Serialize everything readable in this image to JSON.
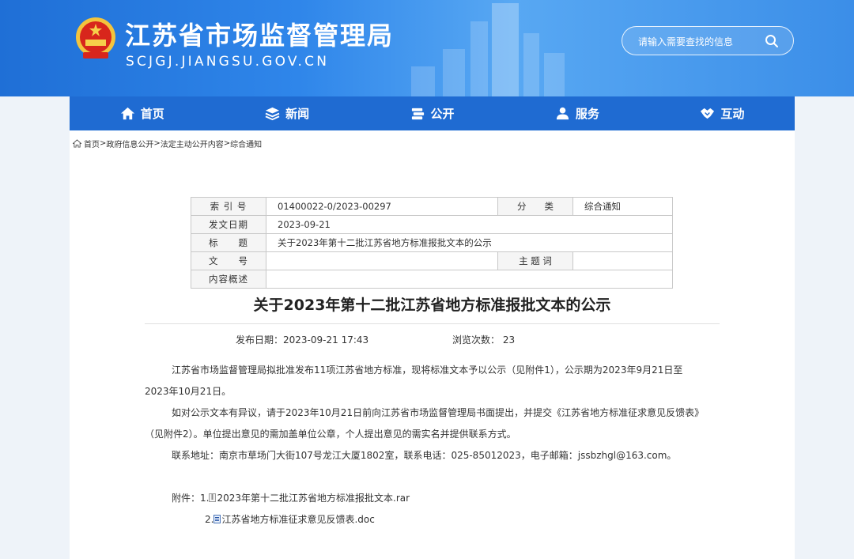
{
  "header": {
    "site_title": "江苏省市场监督管理局",
    "site_domain": "SCJGJ.JIANGSU.GOV.CN",
    "search_placeholder": "请输入需要查找的信息",
    "emblem_icon": "national-emblem-icon"
  },
  "nav": {
    "items": [
      {
        "label": "首页",
        "icon": "home-icon"
      },
      {
        "label": "新闻",
        "icon": "layers-icon"
      },
      {
        "label": "公开",
        "icon": "book-stack-icon"
      },
      {
        "label": "服务",
        "icon": "users-icon"
      },
      {
        "label": "互动",
        "icon": "handshake-icon"
      }
    ]
  },
  "breadcrumb": {
    "items": [
      "首页",
      "政府信息公开",
      "法定主动公开内容",
      "综合通知"
    ],
    "separator": ">"
  },
  "meta_table": {
    "index_label": "索 引 号",
    "index_value": "01400022-0/2023-00297",
    "category_label": "分　　类",
    "category_value": "综合通知",
    "date_label": "发文日期",
    "date_value": "2023-09-21",
    "title_label": "标　　题",
    "title_value": "关于2023年第十二批江苏省地方标准报批文本的公示",
    "doc_no_label": "文　　号",
    "doc_no_value": "",
    "keywords_label": "主 题 词",
    "keywords_value": "",
    "summary_label": "内容概述",
    "summary_value": ""
  },
  "article": {
    "title": "关于2023年第十二批江苏省地方标准报批文本的公示",
    "publish_label": "发布日期：",
    "publish_value": "2023-09-21 17:43",
    "views_label": "浏览次数：",
    "views_value": "23",
    "para1": "江苏省市场监督管理局拟批准发布11项江苏省地方标准，现将标准文本予以公示（见附件1），公示期为2023年9月21日至",
    "para1_cont": "2023年10月21日。",
    "para2": "如对公示文本有异议，请于2023年10月21日前向江苏省市场监督管理局书面提出，并提交《江苏省地方标准征求意见反馈表》",
    "para2_cont": "（见附件2）。单位提出意见的需加盖单位公章，个人提出意见的需实名并提供联系方式。",
    "para3": "联系地址：南京市草场门大街107号龙江大厦1802室，联系电话：025-85012023，电子邮箱：jssbzhgl@163.com。",
    "attach_label": "附件：",
    "attachments": [
      {
        "num": "1.",
        "name": "2023年第十二批江苏省地方标准报批文本.rar",
        "icon": "rar-file-icon"
      },
      {
        "num": "2.",
        "name": "江苏省地方标准征求意见反馈表.doc",
        "icon": "doc-file-icon"
      }
    ]
  },
  "colors": {
    "nav_bg": "#1f6bd2",
    "banner_start": "#1f6fd6",
    "page_bg": "#eef3f9"
  }
}
